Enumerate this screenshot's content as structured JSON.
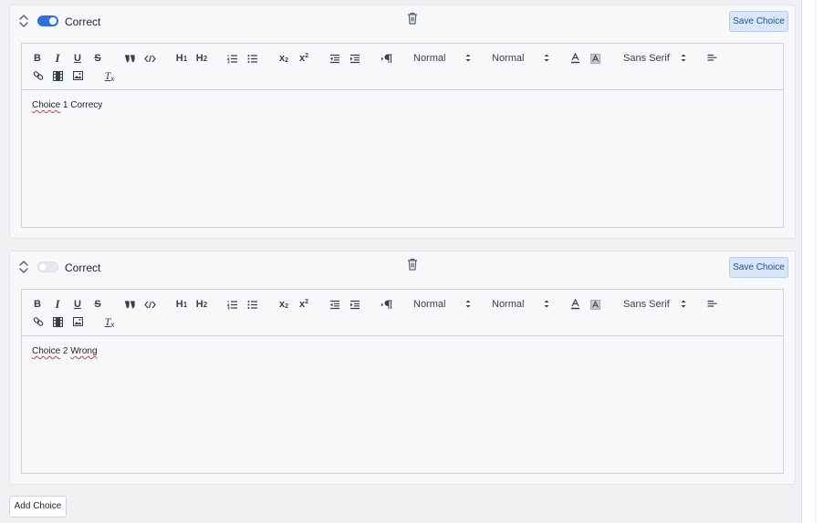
{
  "choices": [
    {
      "toggle_label": "Correct",
      "is_correct": true,
      "save_label": "Save Choice",
      "content_words": [
        "Choice",
        "1",
        "Correcy"
      ]
    },
    {
      "toggle_label": "Correct",
      "is_correct": false,
      "save_label": "Save Choice",
      "content_words": [
        "Choice",
        "2",
        "Wrong"
      ]
    }
  ],
  "toolbar": {
    "header1": "H",
    "header2": "H",
    "header1_sub": "1",
    "header2_sub": "2",
    "bold": "B",
    "italic": "I",
    "underline": "U",
    "strike": "S",
    "subscript": "x",
    "superscript": "x",
    "size_value": "Normal",
    "header_value": "Normal",
    "font_value": "Sans Serif",
    "clean": "T"
  },
  "add_choice_label": "Add Choice",
  "colors": {
    "toggle_on": "#2f6fe0",
    "save_bg": "#dbe7f8",
    "spellcheck": "#e0344a"
  }
}
